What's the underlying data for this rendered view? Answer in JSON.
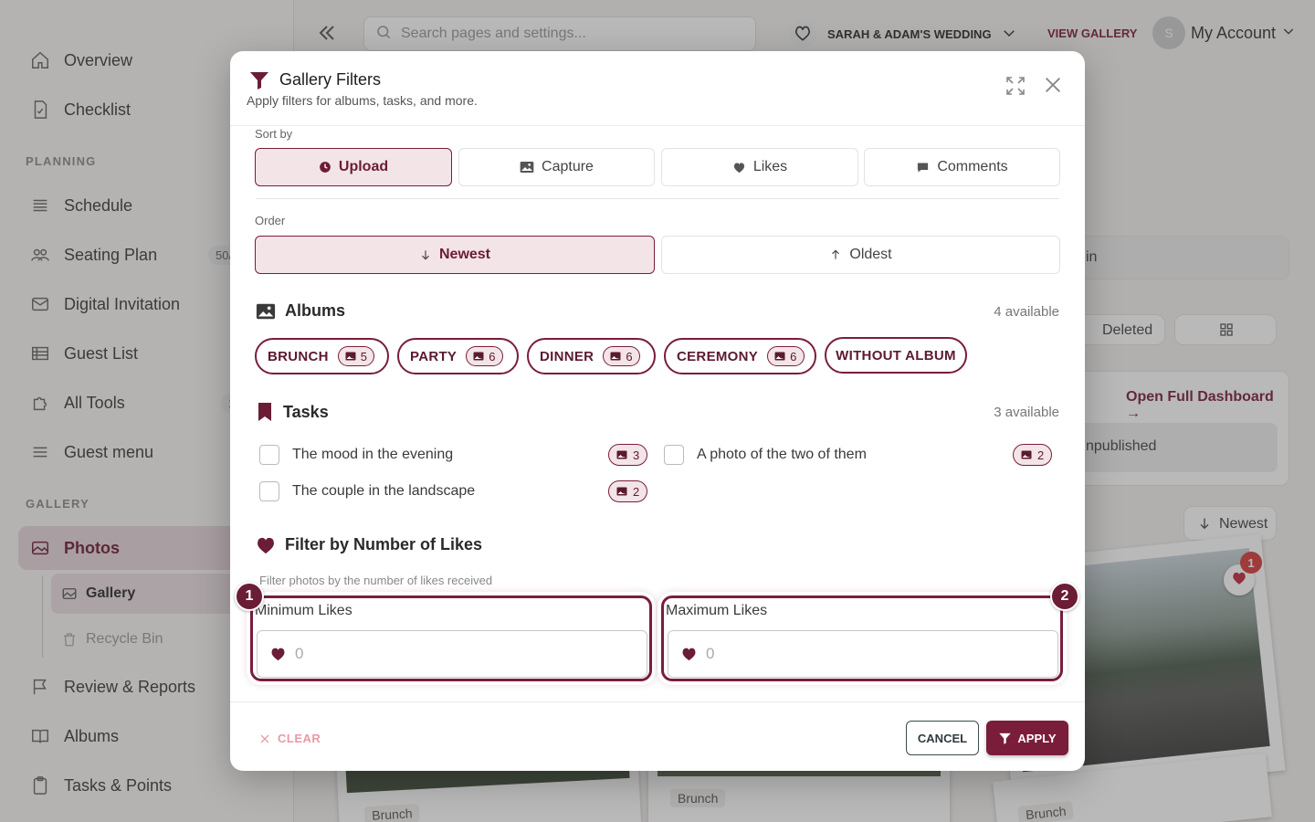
{
  "sidebar": {
    "items_top": [
      {
        "label": "Overview",
        "icon": "home-icon"
      },
      {
        "label": "Checklist",
        "icon": "checklist-icon"
      }
    ],
    "planning_label": "PLANNING",
    "planning_items": [
      {
        "label": "Schedule",
        "icon": "list-icon",
        "count": ""
      },
      {
        "label": "Seating Plan",
        "icon": "people-icon",
        "count": "50/"
      },
      {
        "label": "Digital Invitation",
        "icon": "mail-icon",
        "count": ""
      },
      {
        "label": "Guest List",
        "icon": "table-icon",
        "count": ""
      },
      {
        "label": "All Tools",
        "icon": "puzzle-icon",
        "count": "1"
      },
      {
        "label": "Guest menu",
        "icon": "menu-icon",
        "count": ""
      }
    ],
    "gallery_label": "GALLERY",
    "photos_label": "Photos",
    "sub_items": [
      {
        "label": "Gallery"
      },
      {
        "label": "Recycle Bin"
      }
    ],
    "bottom_items": [
      {
        "label": "Review & Reports",
        "icon": "flag-icon"
      },
      {
        "label": "Albums",
        "icon": "book-icon"
      },
      {
        "label": "Tasks & Points",
        "icon": "clipboard-icon"
      }
    ]
  },
  "topbar": {
    "search_placeholder": "Search pages and settings...",
    "wedding_name": "SARAH & ADAM'S WEDDING",
    "view_gallery": "VIEW GALLERY",
    "avatar_initial": "S",
    "account_label": "My Account"
  },
  "background": {
    "partial_in": "in",
    "deleted": "Deleted",
    "open_dashboard": "Open Full Dashboard →",
    "unpublished": "npublished",
    "newest": "Newest",
    "notif_count": "1",
    "brunch_tags": [
      "Brunch",
      "Brunch",
      "Brunch"
    ]
  },
  "modal": {
    "title": "Gallery Filters",
    "subtitle": "Apply filters for albums, tasks, and more.",
    "sort_by_label": "Sort by",
    "sort_options": [
      {
        "label": "Upload",
        "icon": "clock-icon",
        "active": true
      },
      {
        "label": "Capture",
        "icon": "image-icon",
        "active": false
      },
      {
        "label": "Likes",
        "icon": "heart-icon",
        "active": false
      },
      {
        "label": "Comments",
        "icon": "comment-icon",
        "active": false
      }
    ],
    "order_label": "Order",
    "order_options": [
      {
        "label": "Newest",
        "icon": "arrow-down-icon",
        "active": true
      },
      {
        "label": "Oldest",
        "icon": "arrow-up-icon",
        "active": false
      }
    ],
    "albums_title": "Albums",
    "albums_available": "4 available",
    "albums": [
      {
        "label": "BRUNCH",
        "count": "5"
      },
      {
        "label": "PARTY",
        "count": "6"
      },
      {
        "label": "DINNER",
        "count": "6"
      },
      {
        "label": "CEREMONY",
        "count": "6"
      },
      {
        "label": "WITHOUT ALBUM",
        "count": ""
      }
    ],
    "tasks_title": "Tasks",
    "tasks_available": "3 available",
    "tasks": [
      {
        "label": "The mood in the evening",
        "count": "3"
      },
      {
        "label": "A photo of the two of them",
        "count": "2"
      },
      {
        "label": "The couple in the landscape",
        "count": "2"
      }
    ],
    "likes_title": "Filter by Number of Likes",
    "likes_hint": "Filter photos by the number of likes received",
    "min_label": "Minimum Likes",
    "max_label": "Maximum Likes",
    "min_placeholder": "0",
    "max_placeholder": "0",
    "step_1": "1",
    "step_2": "2",
    "clear_label": "CLEAR",
    "cancel_label": "CANCEL",
    "apply_label": "APPLY"
  },
  "colors": {
    "accent": "#7a1d3a",
    "accent_light": "#f3e4e8"
  }
}
